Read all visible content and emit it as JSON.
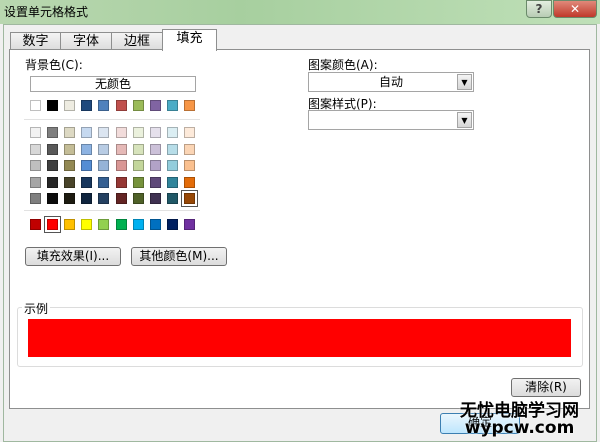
{
  "window": {
    "title": "设置单元格格式",
    "help": "?",
    "close": "✕"
  },
  "tabs": [
    {
      "label": "数字"
    },
    {
      "label": "字体"
    },
    {
      "label": "边框"
    },
    {
      "label": "填充",
      "selected": true
    }
  ],
  "background": {
    "label": "背景色(C):",
    "no_color": "无颜色",
    "theme_row": [
      "#FFFFFF",
      "#000000",
      "#EEECE1",
      "#1F497D",
      "#4F81BD",
      "#C0504D",
      "#9BBB59",
      "#8064A2",
      "#4BACC6",
      "#F79646"
    ],
    "tint_rows": [
      [
        "#F2F2F2",
        "#7F7F7F",
        "#DDD9C3",
        "#C6D9F0",
        "#DBE5F1",
        "#F2DCDB",
        "#EBF1DD",
        "#E5E0EC",
        "#DBEEF3",
        "#FDEADA"
      ],
      [
        "#D8D8D8",
        "#595959",
        "#C4BD97",
        "#8DB3E2",
        "#B8CCE4",
        "#E5B9B7",
        "#D7E3BC",
        "#CCC1D9",
        "#B7DDE8",
        "#FBD5B5"
      ],
      [
        "#BFBFBF",
        "#3F3F3F",
        "#938953",
        "#548DD4",
        "#95B3D7",
        "#D99694",
        "#C3D69B",
        "#B2A2C7",
        "#92CDDC",
        "#FAC08F"
      ],
      [
        "#A5A5A5",
        "#262626",
        "#494429",
        "#17365D",
        "#366092",
        "#953734",
        "#76923C",
        "#5F497A",
        "#31859B",
        "#E36C09"
      ],
      [
        "#7F7F7F",
        "#0C0C0C",
        "#1D1B10",
        "#0F243E",
        "#244061",
        "#632423",
        "#4F6128",
        "#3F3151",
        "#205867",
        "#974806"
      ]
    ],
    "standard_row": [
      "#C00000",
      "#FF0000",
      "#FFC000",
      "#FFFF00",
      "#92D050",
      "#00B050",
      "#00B0F0",
      "#0070C0",
      "#002060",
      "#7030A0"
    ],
    "selected_color": "#FF0000",
    "fill_effects": "填充效果(I)...",
    "more_colors": "其他颜色(M)..."
  },
  "pattern": {
    "color_label": "图案颜色(A):",
    "color_value": "自动",
    "style_label": "图案样式(P):",
    "style_value": ""
  },
  "sample": {
    "label": "示例",
    "color": "#FF0000"
  },
  "clear": "清除(R)",
  "ok": "确定",
  "watermark": {
    "line1": "无忧电脑学习网",
    "line2": "wypcw.com"
  }
}
